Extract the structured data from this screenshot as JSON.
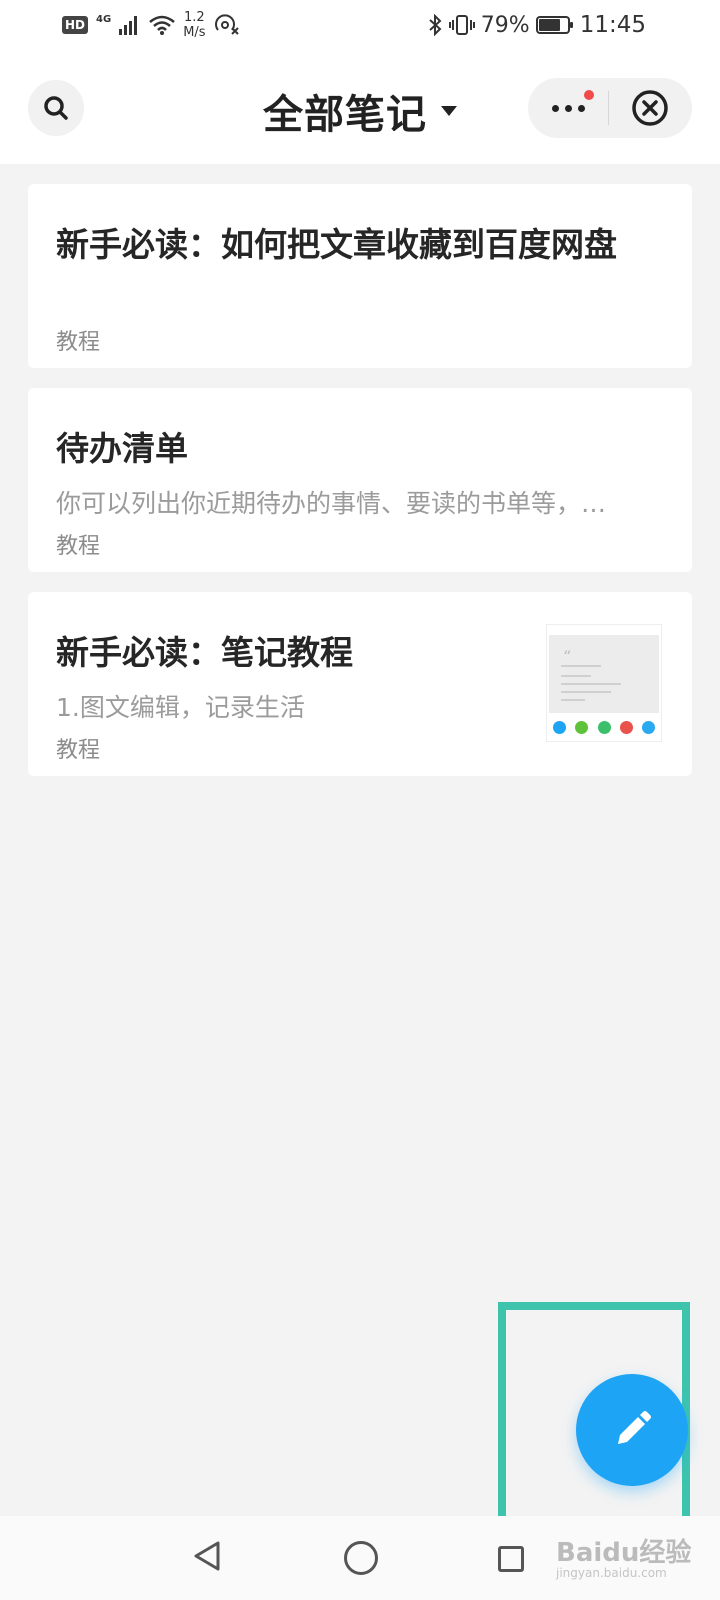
{
  "status_bar": {
    "hd": "HD",
    "network": "4G",
    "speed_value": "1.2",
    "speed_unit": "M/s",
    "battery": "79%",
    "battery_level": 0.79,
    "time": "11:45"
  },
  "header": {
    "title": "全部笔记",
    "icons": {
      "search": "search-icon",
      "more": "more-icon",
      "close": "close-circle-icon",
      "dropdown": "caret-down-icon"
    },
    "notification_dot_color": "#f04a4a"
  },
  "notes": [
    {
      "title": "新手必读：如何把文章收藏到百度网盘",
      "summary": "",
      "tag": "教程"
    },
    {
      "title": "待办清单",
      "summary": "你可以列出你近期待办的事情、要读的书单等，…",
      "tag": "教程"
    },
    {
      "title": "新手必读：笔记教程",
      "summary": "1.图文编辑，记录生活",
      "tag": "教程",
      "has_thumbnail": true
    }
  ],
  "fab": {
    "icon": "pencil-icon",
    "color": "#1ea4f5"
  },
  "highlight_color": "#3ec4ad",
  "watermark": {
    "main": "Baidu经验",
    "sub": "jingyan.baidu.com"
  }
}
